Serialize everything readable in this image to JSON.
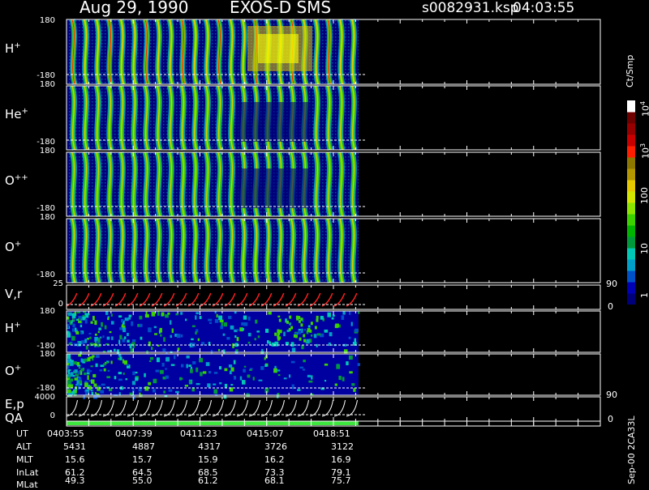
{
  "header": {
    "date": "Aug 29, 1990",
    "instrument": "EXOS-D SMS",
    "file": "s0082931.ksp",
    "time": "04:03:55"
  },
  "panels": [
    {
      "label": "H",
      "sup": "+",
      "top": "180",
      "bottom": "-180"
    },
    {
      "label": "He",
      "sup": "+",
      "top": "180",
      "bottom": "-180"
    },
    {
      "label": "O",
      "sup": "++",
      "top": "180",
      "bottom": "-180"
    },
    {
      "label": "O",
      "sup": "+",
      "top": "180",
      "bottom": "-180"
    },
    {
      "label": "V,r",
      "sup": "",
      "top": "25",
      "bottom": "0"
    },
    {
      "label": "H",
      "sup": "+",
      "top": "180",
      "bottom": "-180"
    },
    {
      "label": "O",
      "sup": "+",
      "top": "180",
      "bottom": "-180"
    },
    {
      "label": "E,p",
      "sup": "",
      "top": "4000",
      "bottom": "0"
    }
  ],
  "qa_label": "QA",
  "right_axis": {
    "vr_top": "90",
    "vr_bottom": "0",
    "ep_top": "90",
    "ep_bottom": "0"
  },
  "colorbar": {
    "unit": "Ct/Smp",
    "labels": [
      "1",
      "10",
      "100",
      "10",
      "10"
    ],
    "exponents": [
      "",
      "",
      "",
      "3",
      "4"
    ],
    "colors": [
      "#00007a",
      "#0000b4",
      "#0050c8",
      "#00a0c8",
      "#00c8b4",
      "#009a3c",
      "#00b400",
      "#3cd200",
      "#8ce600",
      "#d2e600",
      "#e6c800",
      "#b49600",
      "#8c7800",
      "#ff1e00",
      "#c80000",
      "#960000",
      "#6e0000",
      "#ffffff"
    ]
  },
  "ephemeris": {
    "rows": [
      {
        "name": "UT",
        "values": [
          "0403:55",
          "0407:39",
          "0411:23",
          "0415:07",
          "0418:51"
        ]
      },
      {
        "name": "ALT",
        "values": [
          "5431",
          "4887",
          "4317",
          "3726",
          "3122"
        ]
      },
      {
        "name": "MLT",
        "values": [
          "15.6",
          "15.7",
          "15.9",
          "16.2",
          "16.9"
        ]
      },
      {
        "name": "InLat",
        "values": [
          "61.2",
          "64.5",
          "68.5",
          "73.3",
          "79.1"
        ]
      },
      {
        "name": "MLat",
        "values": [
          "49.3",
          "55.0",
          "61.2",
          "68.1",
          "75.7"
        ]
      }
    ]
  },
  "version": "Sep-00 2CA33L",
  "chart_data": {
    "type": "heatmap",
    "x_ticks_ut": [
      "0403:55",
      "0407:39",
      "0411:23",
      "0415:07",
      "0418:51"
    ],
    "data_coverage_ut": [
      "0403:55",
      "0420:30"
    ],
    "spin_cycles": 24,
    "y_range_pitch": [
      -180,
      180
    ],
    "vr_range": [
      0,
      25
    ],
    "ep_range": [
      0,
      4000
    ],
    "colorscale_range": [
      1,
      10000
    ],
    "log_color_scale": true
  }
}
